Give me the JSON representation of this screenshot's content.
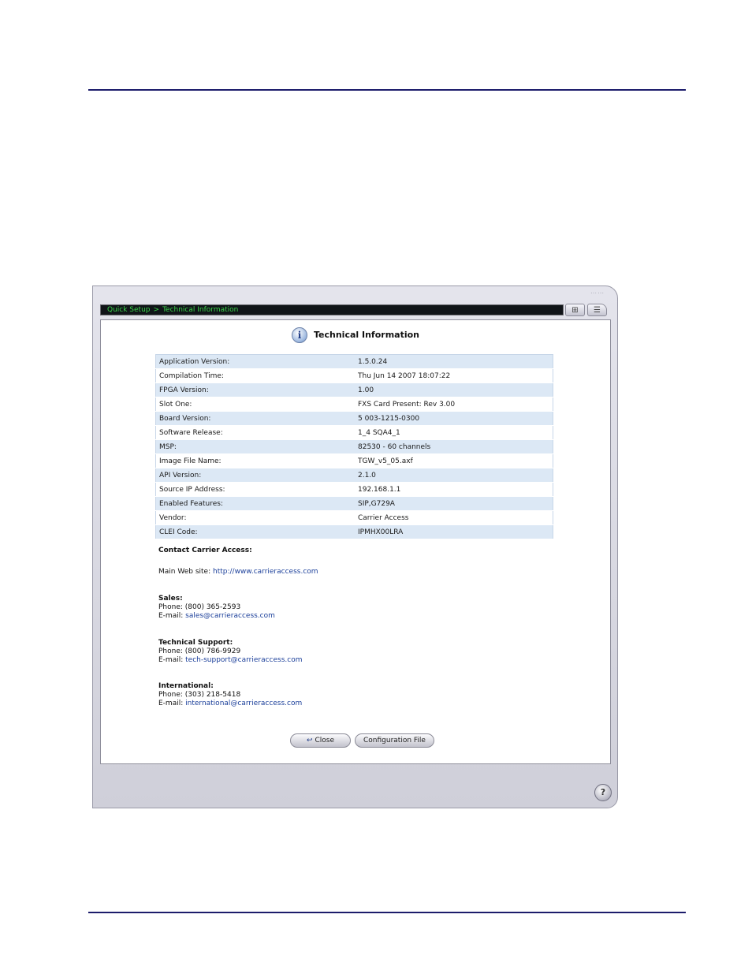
{
  "breadcrumb": {
    "items": [
      "Quick Setup",
      "Technical Information"
    ],
    "separator": ">"
  },
  "page_title": "Technical Information",
  "tech_info": [
    {
      "label": "Application Version:",
      "value": "1.5.0.24"
    },
    {
      "label": "Compilation Time:",
      "value": "Thu Jun 14 2007 18:07:22"
    },
    {
      "label": "FPGA Version:",
      "value": "1.00"
    },
    {
      "label": "Slot One:",
      "value": "FXS Card Present: Rev 3.00"
    },
    {
      "label": "Board Version:",
      "value": "5 003-1215-0300"
    },
    {
      "label": "Software Release:",
      "value": "1_4 SQA4_1"
    },
    {
      "label": "MSP:",
      "value": "82530 - 60 channels"
    },
    {
      "label": "Image File Name:",
      "value": "TGW_v5_05.axf"
    },
    {
      "label": "API Version:",
      "value": "2.1.0"
    },
    {
      "label": "Source IP Address:",
      "value": "192.168.1.1"
    },
    {
      "label": "Enabled Features:",
      "value": "SIP,G729A"
    },
    {
      "label": "Vendor:",
      "value": "Carrier Access"
    },
    {
      "label": "CLEI Code:",
      "value": "IPMHX00LRA"
    }
  ],
  "contact": {
    "heading": "Contact Carrier Access:",
    "website_label": "Main Web site:",
    "website_url": "http://www.carrieraccess.com",
    "sales": {
      "heading": "Sales:",
      "phone": "Phone: (800) 365-2593",
      "email_label": "E-mail:",
      "email": "sales@carrieraccess.com"
    },
    "support": {
      "heading": "Technical Support:",
      "phone": "Phone: (800) 786-9929",
      "email_label": "E-mail:",
      "email": "tech-support@carrieraccess.com"
    },
    "international": {
      "heading": "International:",
      "phone": "Phone: (303) 218-5418",
      "email_label": "E-mail:",
      "email": "international@carrieraccess.com"
    }
  },
  "buttons": {
    "close": "Close",
    "config": "Configuration File"
  },
  "icons": {
    "info": "info-icon",
    "close": "return-arrow-icon",
    "help": "help-icon",
    "network": "network-icon",
    "list": "list-icon"
  },
  "colors": {
    "rule": "#1c1c6b",
    "breadcrumb_text": "#3bd44a",
    "row_stripe": "#dce8f5",
    "link": "#1b3f9a"
  }
}
